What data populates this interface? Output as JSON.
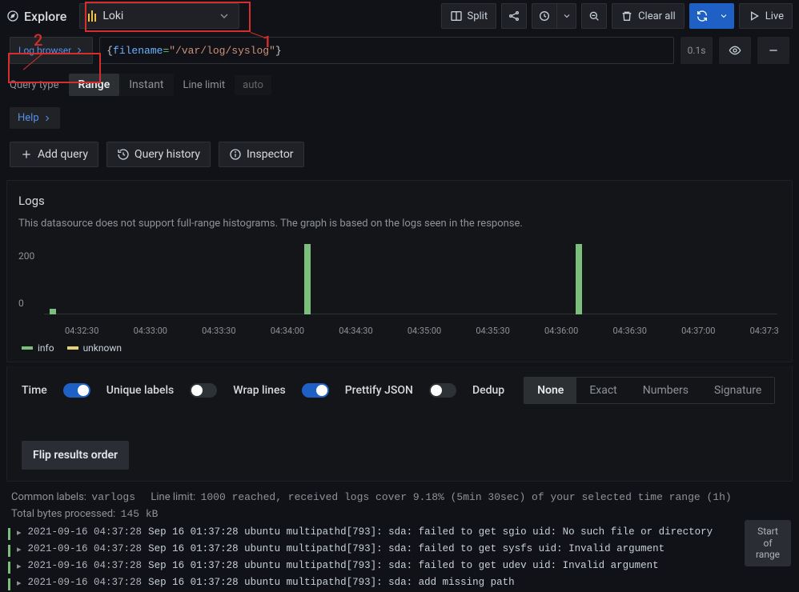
{
  "header": {
    "title": "Explore",
    "datasource": "Loki",
    "buttons": {
      "split": "Split",
      "clear_all": "Clear all",
      "live": "Live"
    }
  },
  "query": {
    "log_browser_label": "Log browser",
    "expr": {
      "key": "filename",
      "op": "=",
      "value": "\"/var/log/syslog\""
    },
    "duration": "0.1s",
    "query_type_label": "Query type",
    "query_type_options": [
      "Range",
      "Instant"
    ],
    "query_type_selected": "Range",
    "line_limit_label": "Line limit",
    "line_limit_value": "auto",
    "help_label": "Help",
    "actions": {
      "add_query": "Add query",
      "query_history": "Query history",
      "inspector": "Inspector"
    }
  },
  "panel": {
    "title": "Logs",
    "note": "This datasource does not support full-range histograms. The graph is based on the logs seen in the response."
  },
  "chart_data": {
    "type": "bar",
    "ylabel": "",
    "yticks": [
      0,
      200
    ],
    "ylim": [
      0,
      300
    ],
    "x_ticks": [
      "04:32:30",
      "04:33:00",
      "04:33:30",
      "04:34:00",
      "04:34:30",
      "04:35:00",
      "04:35:30",
      "04:36:00",
      "04:36:30",
      "04:37:00",
      "04:37:3"
    ],
    "series": [
      {
        "name": "info",
        "color": "#7cbf7c"
      },
      {
        "name": "unknown",
        "color": "#e8d075"
      }
    ],
    "bars": [
      {
        "x_frac": 0.008,
        "value": 25,
        "series": "info"
      },
      {
        "x_frac": 0.355,
        "value": 300,
        "series": "info"
      },
      {
        "x_frac": 0.725,
        "value": 300,
        "series": "info"
      }
    ]
  },
  "controls": {
    "time": {
      "label": "Time",
      "on": true
    },
    "unique_labels": {
      "label": "Unique labels",
      "on": false
    },
    "wrap_lines": {
      "label": "Wrap lines",
      "on": true
    },
    "prettify_json": {
      "label": "Prettify JSON",
      "on": false
    },
    "dedup_label": "Dedup",
    "dedup_options": [
      "None",
      "Exact",
      "Numbers",
      "Signature"
    ],
    "dedup_selected": "None",
    "flip_label": "Flip results order"
  },
  "meta": {
    "common_labels_key": "Common labels:",
    "common_labels_val": "varlogs",
    "line_limit_key": "Line limit:",
    "line_limit_val": "1000 reached, received logs cover 9.18% (5min 30sec) of your selected time range (1h)",
    "bytes_key": "Total bytes processed:",
    "bytes_val": "145 kB"
  },
  "logs": [
    {
      "ts": "2021-09-16 04:37:28",
      "msg": "Sep 16 01:37:28 ubuntu multipathd[793]: sda: failed to get sgio uid: No such file or directory"
    },
    {
      "ts": "2021-09-16 04:37:28",
      "msg": "Sep 16 01:37:28 ubuntu multipathd[793]: sda: failed to get sysfs uid: Invalid argument"
    },
    {
      "ts": "2021-09-16 04:37:28",
      "msg": "Sep 16 01:37:28 ubuntu multipathd[793]: sda: failed to get udev uid: Invalid argument"
    },
    {
      "ts": "2021-09-16 04:37:28",
      "msg": "Sep 16 01:37:28 ubuntu multipathd[793]: sda: add missing path"
    }
  ],
  "start_of_range": {
    "l1": "Start",
    "l2": "of",
    "l3": "range"
  },
  "annotations": {
    "n1": "1",
    "n2": "2"
  }
}
